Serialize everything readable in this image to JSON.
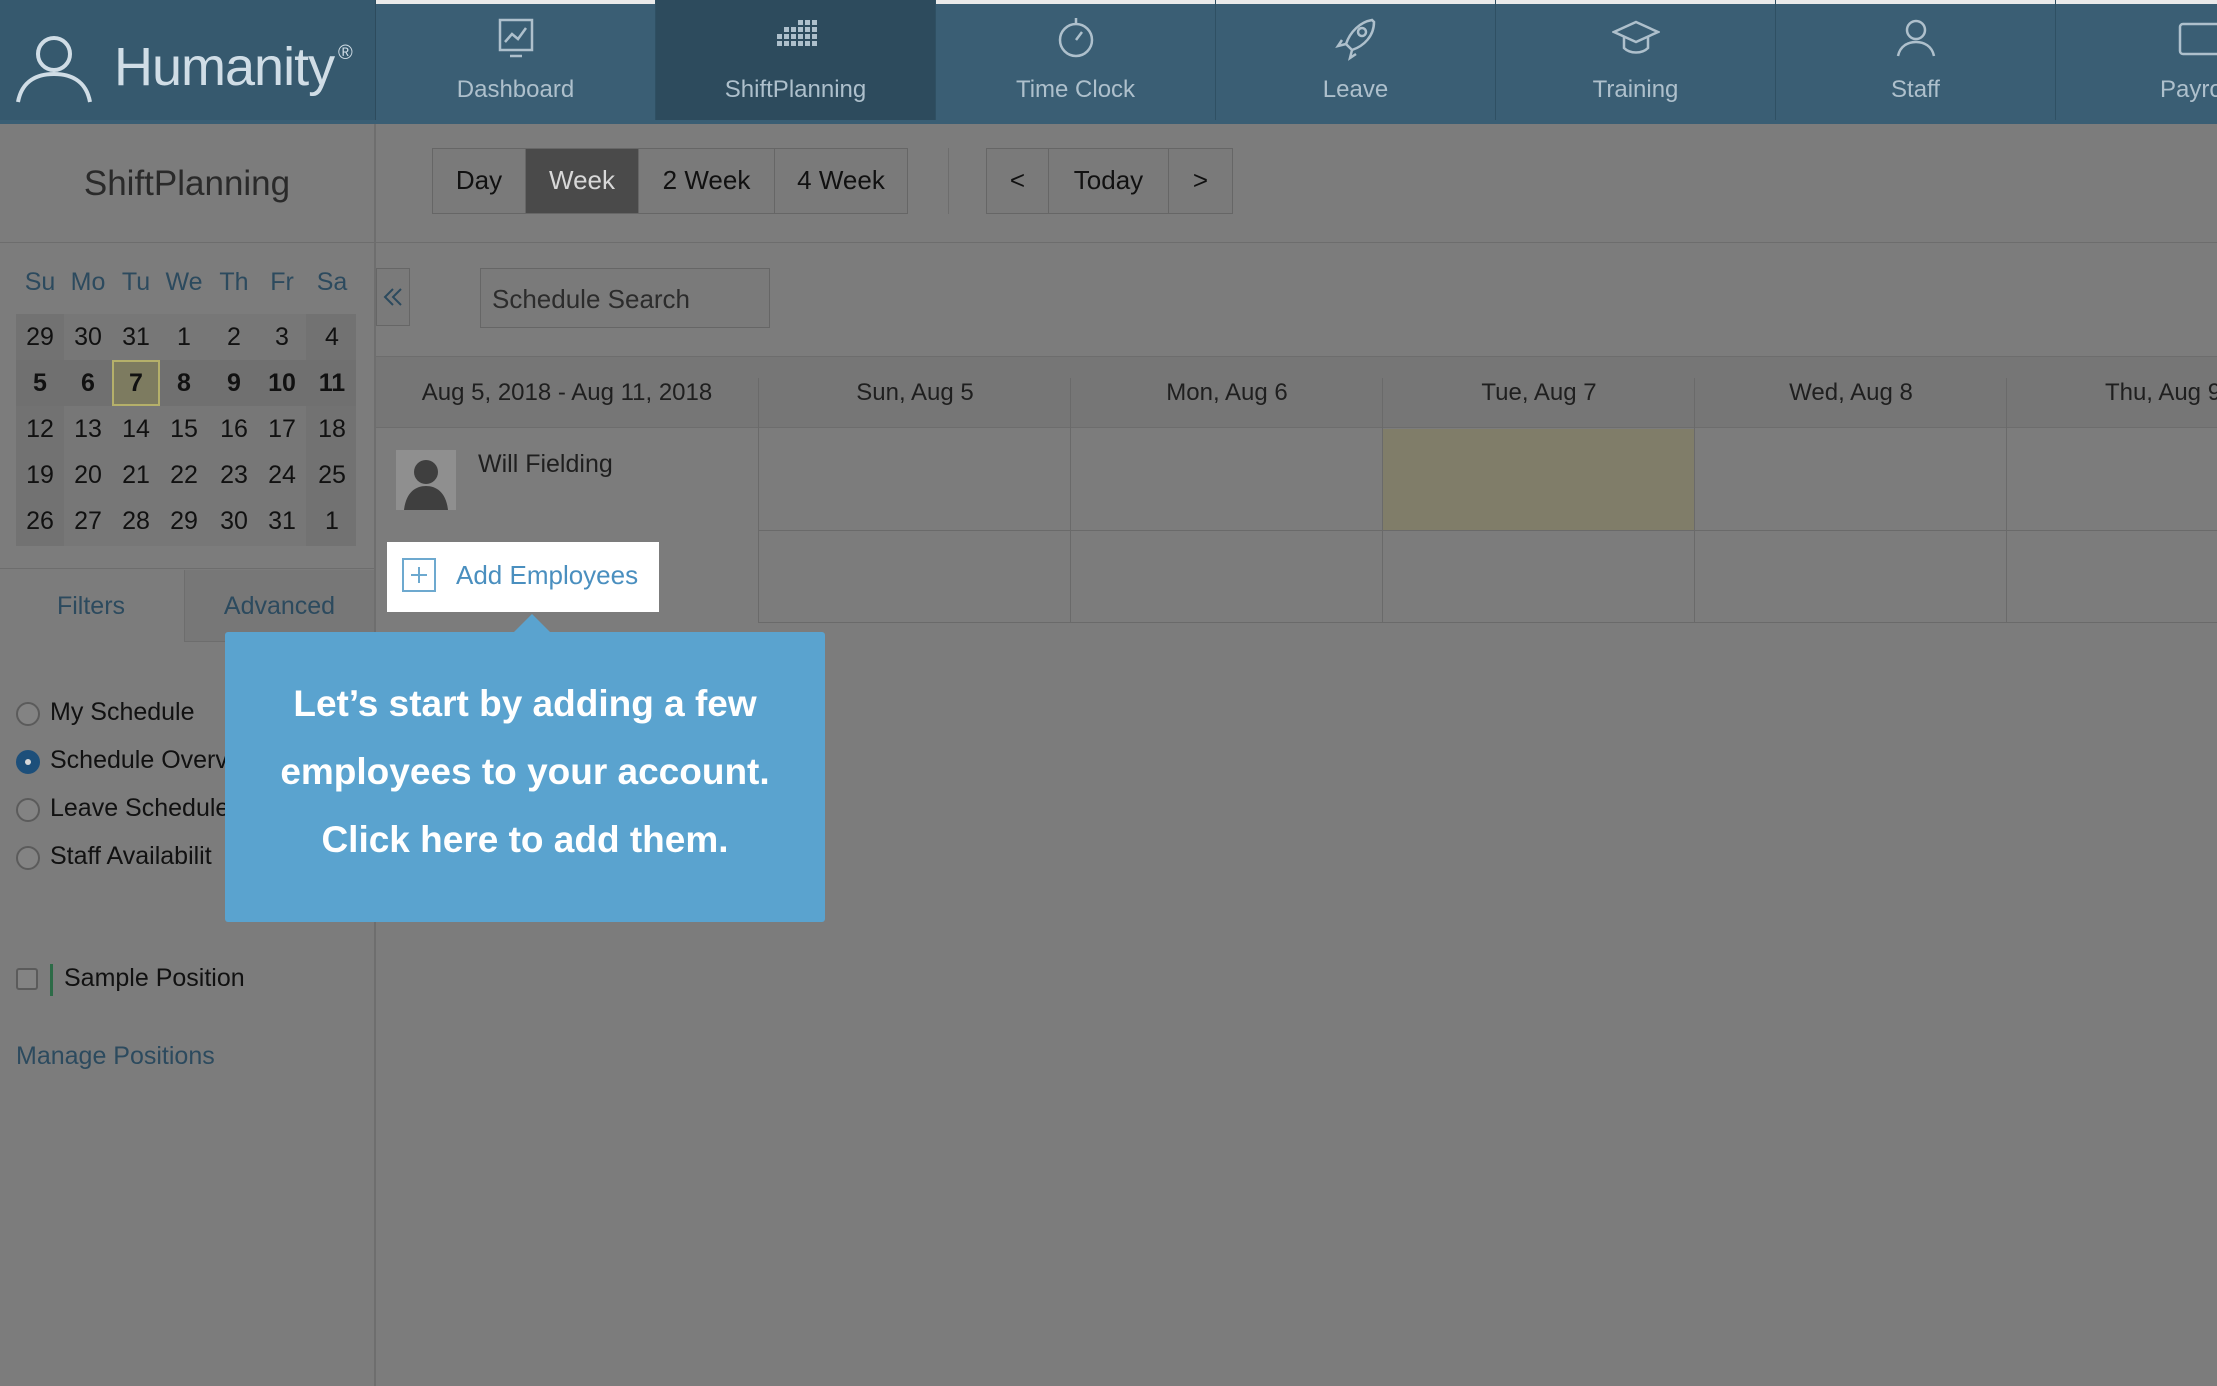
{
  "brand": {
    "name": "Humanity",
    "registered": "®"
  },
  "nav": [
    {
      "label": "Dashboard",
      "icon": "dashboard-chart-icon"
    },
    {
      "label": "ShiftPlanning",
      "icon": "calendar-grid-icon"
    },
    {
      "label": "Time Clock",
      "icon": "stopwatch-icon"
    },
    {
      "label": "Leave",
      "icon": "rocket-icon"
    },
    {
      "label": "Training",
      "icon": "graduation-cap-icon"
    },
    {
      "label": "Staff",
      "icon": "person-icon"
    },
    {
      "label": "Payro",
      "icon": "payroll-icon"
    }
  ],
  "left": {
    "title": "ShiftPlanning",
    "calendar": {
      "weekdays": [
        "Su",
        "Mo",
        "Tu",
        "We",
        "Th",
        "Fr",
        "Sa"
      ],
      "weeks": [
        [
          "29",
          "30",
          "31",
          "1",
          "2",
          "3",
          "4"
        ],
        [
          "5",
          "6",
          "7",
          "8",
          "9",
          "10",
          "11"
        ],
        [
          "12",
          "13",
          "14",
          "15",
          "16",
          "17",
          "18"
        ],
        [
          "19",
          "20",
          "21",
          "22",
          "23",
          "24",
          "25"
        ],
        [
          "26",
          "27",
          "28",
          "29",
          "30",
          "31",
          "1"
        ]
      ],
      "selected_week_index": 1,
      "today": "7"
    },
    "tabs": {
      "filters": "Filters",
      "advanced": "Advanced"
    },
    "views": [
      {
        "label": "My Schedule",
        "checked": false
      },
      {
        "label": "Schedule Overv",
        "checked": true
      },
      {
        "label": "Leave Schedule",
        "checked": false
      },
      {
        "label": "Staff Availabilit",
        "checked": false
      }
    ],
    "position": {
      "label": "Sample Position",
      "checked": false
    },
    "manage_positions": "Manage Positions"
  },
  "toolbar": {
    "views": [
      "Day",
      "Week",
      "2 Week",
      "4 Week"
    ],
    "active_view": "Week",
    "prev": "<",
    "today": "Today",
    "next": ">"
  },
  "search": {
    "placeholder": "Schedule Search"
  },
  "grid": {
    "range": "Aug 5, 2018 - Aug 11, 2018",
    "days": [
      "Sun, Aug 5",
      "Mon, Aug 6",
      "Tue, Aug 7",
      "Wed, Aug 8",
      "Thu, Aug 9"
    ],
    "employees": [
      {
        "name": "Will Fielding"
      }
    ]
  },
  "add_employees": "Add Employees",
  "tooltip": {
    "line1": "Let’s start by adding a few",
    "line2": "employees to your account.",
    "line3": "Click here to add them."
  },
  "colors": {
    "topbar": "#3a5e74",
    "accent": "#5aa3cf",
    "link": "#2c4a5e",
    "overlay": "#7c7c7c"
  }
}
